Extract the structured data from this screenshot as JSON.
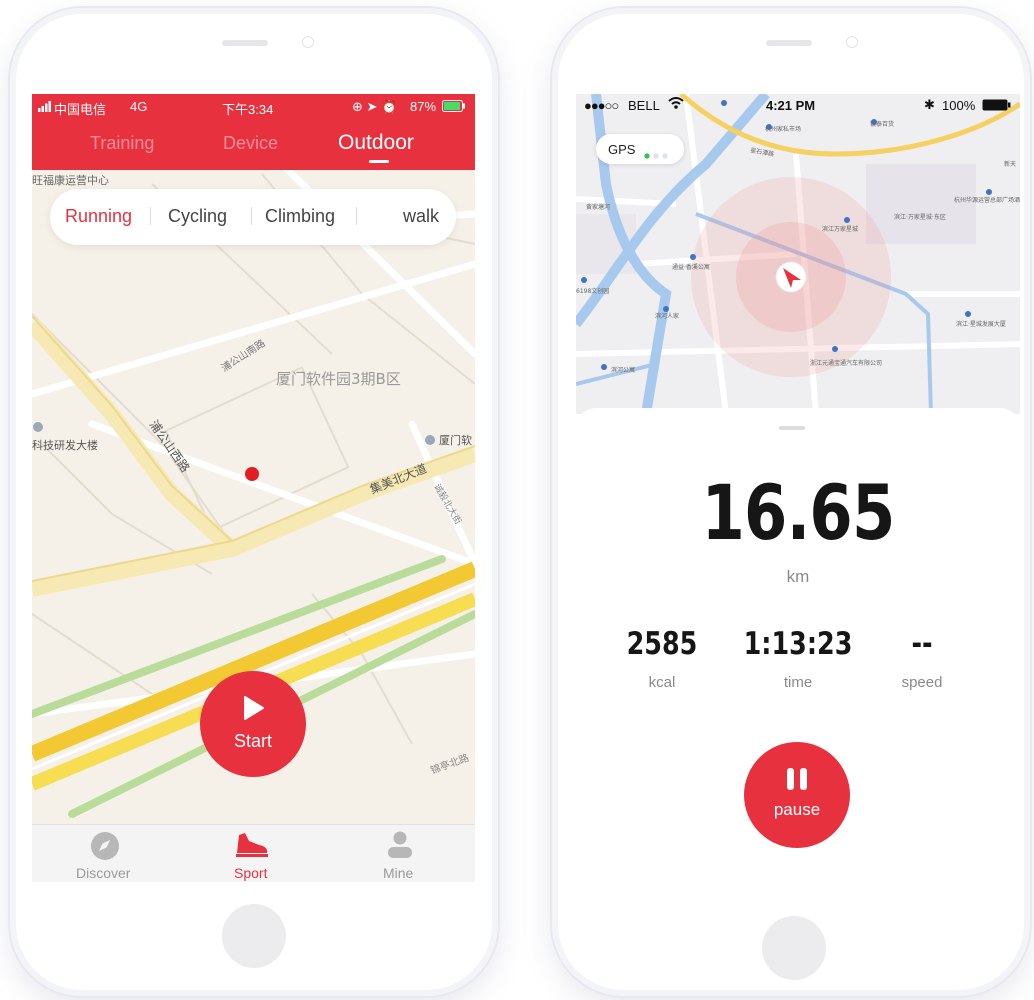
{
  "left_phone": {
    "status": {
      "carrier": "中国电信",
      "network": "4G",
      "time": "下午3:34",
      "battery": "87%"
    },
    "tabs": [
      {
        "label": "Training",
        "active": false
      },
      {
        "label": "Device",
        "active": false
      },
      {
        "label": "Outdoor",
        "active": true
      }
    ],
    "sport_types": [
      {
        "label": "Running",
        "selected": true
      },
      {
        "label": "Cycling",
        "selected": false
      },
      {
        "label": "Climbing",
        "selected": false
      },
      {
        "label": "walk",
        "selected": false
      }
    ],
    "map": {
      "top_label": "旺福康运营中心",
      "area_label": "厦门软件园3期B区",
      "road_label_1": "集美北大道",
      "road_label_2": "浦公山西路",
      "road_label_3": "浦公山南路",
      "poi_left": "科技研发大楼",
      "poi_right": "厦门软",
      "road_label_4": "锦亭北路",
      "road_label_5": "诚毅北大街"
    },
    "start_button": {
      "label": "Start"
    },
    "bottom_tabs": [
      {
        "label": "Discover",
        "icon": "compass-icon",
        "active": false
      },
      {
        "label": "Sport",
        "icon": "running-shoe-icon",
        "active": true
      },
      {
        "label": "Mine",
        "icon": "person-icon",
        "active": false
      }
    ]
  },
  "right_phone": {
    "status": {
      "carrier": "BELL",
      "time": "4:21 PM",
      "battery": "100%"
    },
    "gps_label": "GPS",
    "map": {
      "labels": [
        "杭州家私市场",
        "银泰百货",
        "星石潭路",
        "黄家塘河",
        "滨江万家星城",
        "滨江·万家星城·东区",
        "杭州华源运营总部广场酒店",
        "通益·香溪公寓",
        "6198文创园",
        "滨河人家",
        "滨江·星城发展大厦",
        "浙江元通宝通汽车有限公司",
        "滨河公寓",
        "新天"
      ]
    },
    "distance": {
      "value": "16.65",
      "unit": "km"
    },
    "stats": [
      {
        "value": "2585",
        "label": "kcal"
      },
      {
        "value": "1:13:23",
        "label": "time"
      },
      {
        "value": "--",
        "label": "speed"
      }
    ],
    "pause_button": {
      "label": "pause"
    }
  },
  "colors": {
    "accent": "#e8313e",
    "gps_dot": "#2fc15a"
  }
}
